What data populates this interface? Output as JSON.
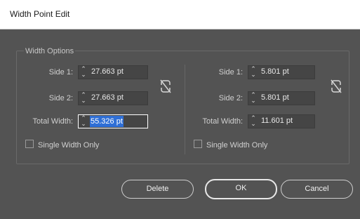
{
  "window": {
    "title": "Width Point Edit"
  },
  "group": {
    "label": "Width Options"
  },
  "left": {
    "side1_label": "Side 1:",
    "side1_value": "27.663 pt",
    "side2_label": "Side 2:",
    "side2_value": "27.663 pt",
    "total_label": "Total Width:",
    "total_value": "55.326 pt",
    "checkbox_label": "Single Width Only"
  },
  "right": {
    "side1_label": "Side 1:",
    "side1_value": "5.801 pt",
    "side2_label": "Side 2:",
    "side2_value": "5.801 pt",
    "total_label": "Total Width:",
    "total_value": "11.601 pt",
    "checkbox_label": "Single Width Only"
  },
  "buttons": {
    "delete": "Delete",
    "ok": "OK",
    "cancel": "Cancel"
  },
  "colors": {
    "background": "#535353",
    "selection": "#2f6fd6"
  },
  "icons": {
    "spinner": "spinner-icon",
    "unlink": "unlink-icon"
  }
}
